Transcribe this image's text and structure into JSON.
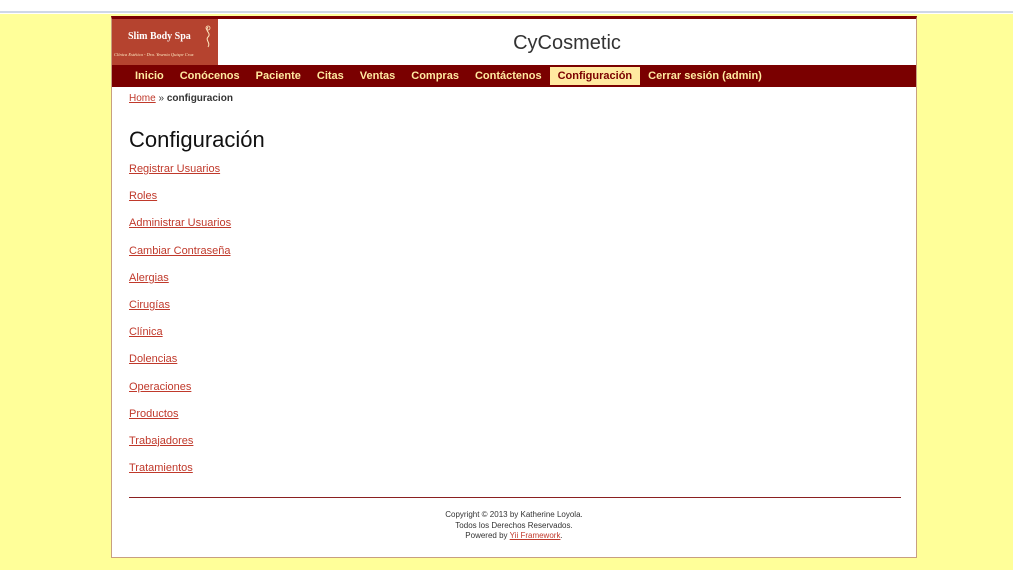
{
  "header": {
    "logo": {
      "title": "Slim Body Spa",
      "subtitle": "Clínica Estética - Dra. Yesenia Quispe Cruz"
    },
    "site_title": "CyCosmetic"
  },
  "nav": {
    "items": [
      {
        "label": "Inicio",
        "active": false
      },
      {
        "label": "Conócenos",
        "active": false
      },
      {
        "label": "Paciente",
        "active": false
      },
      {
        "label": "Citas",
        "active": false
      },
      {
        "label": "Ventas",
        "active": false
      },
      {
        "label": "Compras",
        "active": false
      },
      {
        "label": "Contáctenos",
        "active": false
      },
      {
        "label": "Configuración",
        "active": true
      },
      {
        "label": "Cerrar sesión (admin)",
        "active": false
      }
    ]
  },
  "breadcrumb": {
    "home": "Home",
    "separator": "»",
    "current": "configuracion"
  },
  "page_title": "Configuración",
  "links": [
    "Registrar Usuarios",
    "Roles",
    "Administrar Usuarios",
    "Cambiar Contraseña",
    "Alergias",
    "Cirugías",
    "Clínica",
    "Dolencias",
    "Operaciones",
    "Productos",
    "Trabajadores",
    "Tratamientos"
  ],
  "footer": {
    "copyright": "Copyright © 2013 by Katherine Loyola.",
    "rights": "Todos los Derechos Reservados.",
    "powered_prefix": "Powered by",
    "powered_link": "Yii Framework",
    "powered_suffix": "."
  },
  "colors": {
    "background": "#ffff99",
    "nav_bg": "#7a0000",
    "nav_text": "#ffe9a0",
    "link": "#c0392b",
    "logo_bg": "#b5432f"
  }
}
